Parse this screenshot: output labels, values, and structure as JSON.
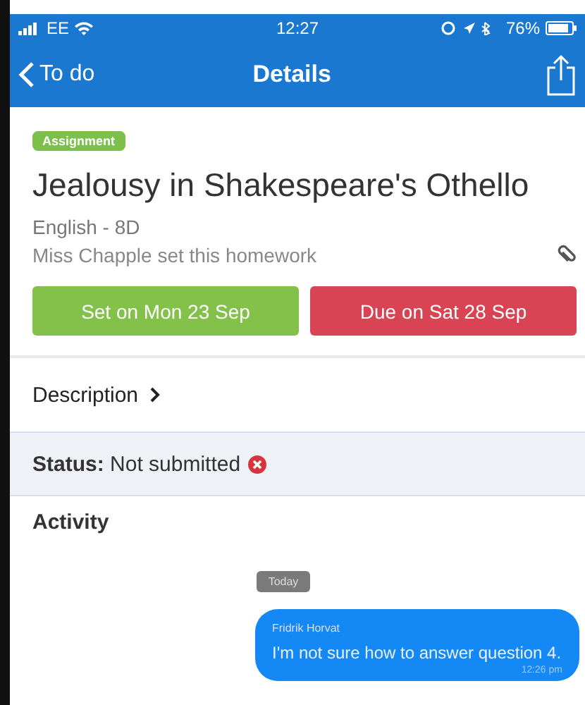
{
  "status_bar": {
    "carrier": "EE",
    "time": "12:27",
    "battery": "76%"
  },
  "nav": {
    "back": "To do",
    "title": "Details"
  },
  "tag": "Assignment",
  "title": "Jealousy in Shakespeare's Othello",
  "subject": "English - 8D",
  "setter": "Miss Chapple set this homework",
  "dates": [
    {
      "kind": "set",
      "label": "Set on Mon 23 Sep"
    },
    {
      "kind": "due",
      "label": "Due on Sat 28 Sep"
    }
  ],
  "description": "Description",
  "status": {
    "label": "Status:",
    "value": "Not submitted",
    "submitted": false
  },
  "activity": {
    "heading": "Activity",
    "day": "Today",
    "messages": [
      {
        "author": "Fridrik Horvat",
        "text": "I'm not sure how to answer question 4.",
        "time": "12:26 pm"
      }
    ]
  }
}
